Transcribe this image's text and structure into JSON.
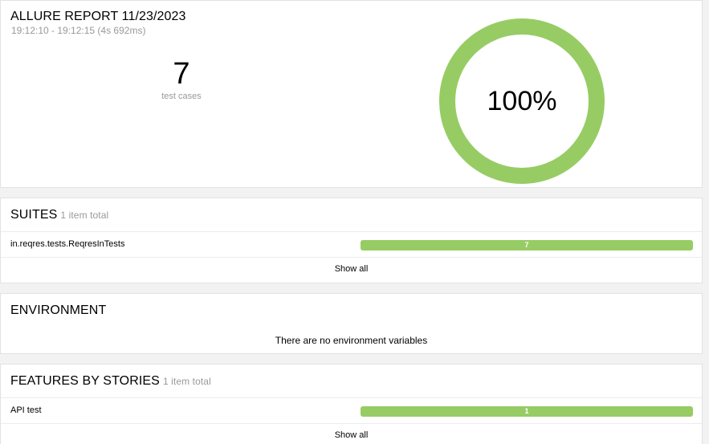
{
  "summary": {
    "title": "ALLURE REPORT 11/23/2023",
    "time": "19:12:10 - 19:12:15 (4s 692ms)",
    "count": "7",
    "count_label": "test cases",
    "percent": "100%",
    "pass_fraction": 1.0,
    "pass_color": "#97cc64"
  },
  "suites": {
    "title": "SUITES",
    "subtitle": "1 item total",
    "items": [
      {
        "name": "in.reqres.tests.ReqresInTests",
        "count": "7"
      }
    ],
    "show_all": "Show all"
  },
  "environment": {
    "title": "ENVIRONMENT",
    "empty": "There are no environment variables"
  },
  "features": {
    "title": "FEATURES BY STORIES",
    "subtitle": "1 item total",
    "items": [
      {
        "name": "API test",
        "count": "1"
      }
    ],
    "show_all": "Show all"
  }
}
